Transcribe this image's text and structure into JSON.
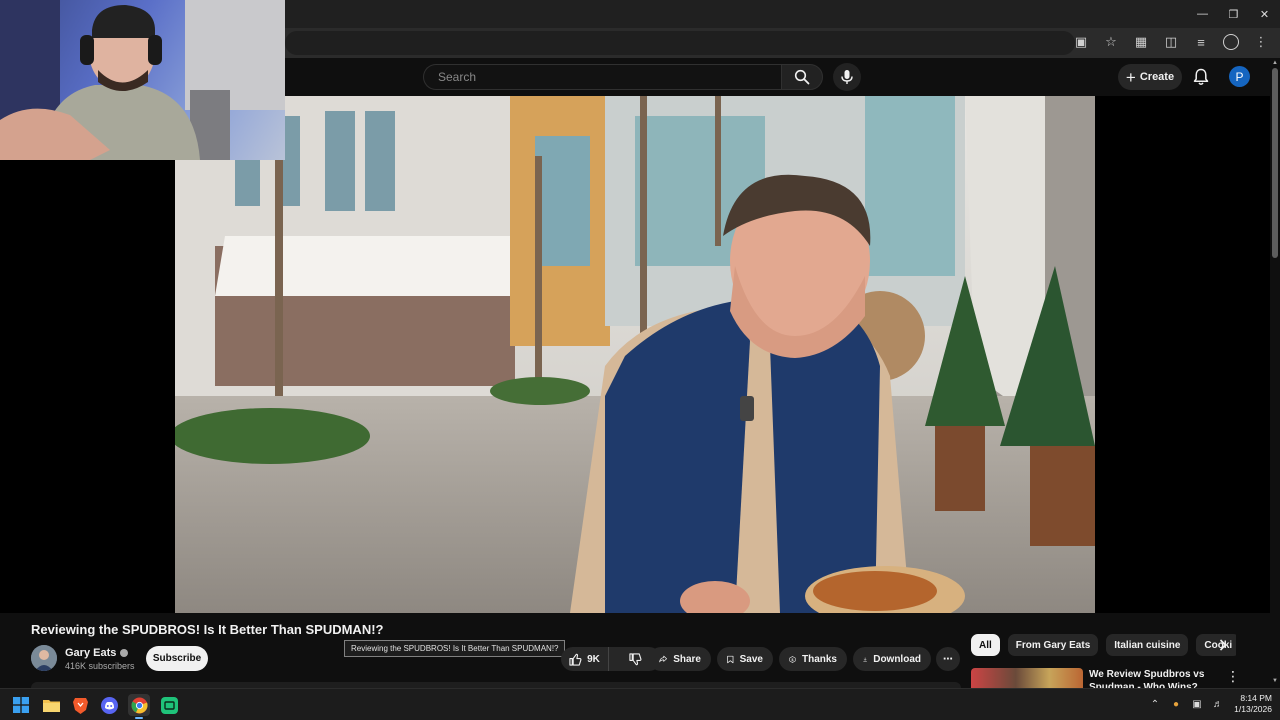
{
  "masthead": {
    "search_placeholder": "Search",
    "create_label": "Create",
    "avatar_letter": "P"
  },
  "video": {
    "title": "Reviewing the SPUDBROS! Is It Better Than SPUDMAN!?",
    "tooltip": "Reviewing the SPUDBROS! Is It Better Than SPUDMAN!?"
  },
  "channel": {
    "name": "Gary Eats",
    "subscribers": "416K subscribers",
    "subscribe_label": "Subscribe"
  },
  "actions": {
    "like_count": "9K",
    "share_label": "Share",
    "save_label": "Save",
    "thanks_label": "Thanks",
    "download_label": "Download"
  },
  "chips": [
    "All",
    "From Gary Eats",
    "Italian cuisine",
    "Cooki"
  ],
  "recommended": {
    "title": "We Review Spudbros vs Spudman - Who Wins?"
  },
  "taskbar": {
    "time": "8:14 PM",
    "date": "1/13/2026"
  },
  "colors": {
    "background": "#0f0f0f",
    "accent_avatar": "#1565c0",
    "pill": "#272727",
    "chip_active": "#f1f1f1"
  }
}
